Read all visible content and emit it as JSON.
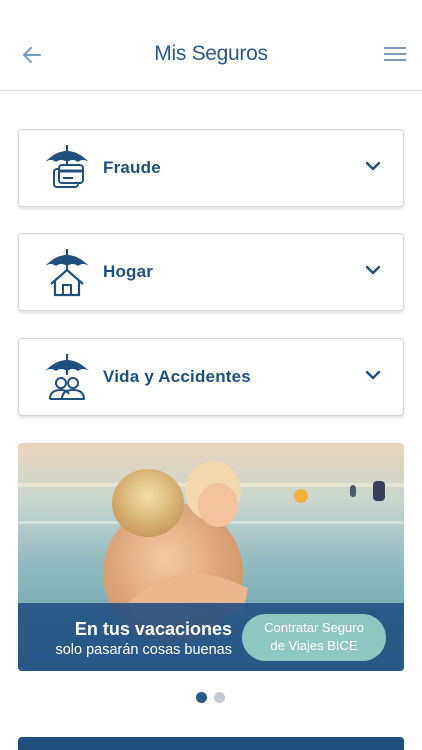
{
  "header": {
    "title": "Mis Seguros",
    "back_icon": "arrow-left-icon",
    "menu_icon": "hamburger-menu-icon"
  },
  "insurance_list": [
    {
      "label": "Fraude",
      "icon": "umbrella-card-icon"
    },
    {
      "label": "Hogar",
      "icon": "umbrella-house-icon"
    },
    {
      "label": "Vida y Accidentes",
      "icon": "umbrella-people-icon"
    }
  ],
  "banner": {
    "headline": "En tus vacaciones",
    "subtext": "solo pasarán cosas buenas",
    "cta_line1": "Contratar Seguro",
    "cta_line2": "de Viajes BICE"
  },
  "carousel": {
    "active_index": 0,
    "count": 2
  },
  "colors": {
    "primary": "#1f4f7d",
    "title": "#2b5a8a",
    "accent": "#8fc7c1",
    "dot_active": "#2b5a8a",
    "dot_inactive": "#c5ccd6"
  }
}
